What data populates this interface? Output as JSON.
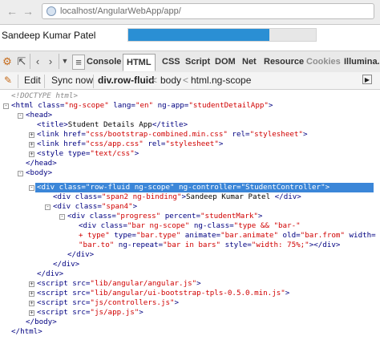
{
  "browser": {
    "url": "localhost/AngularWebApp/app/"
  },
  "page": {
    "student_name": "Sandeep Kumar Patel",
    "progress_percent": 75
  },
  "firebug": {
    "tabs": [
      {
        "label": "Console",
        "active": false,
        "dim": false
      },
      {
        "label": "HTML",
        "active": true,
        "dim": false
      },
      {
        "label": "CSS",
        "active": false,
        "dim": false
      },
      {
        "label": "Script",
        "active": false,
        "dim": false
      },
      {
        "label": "DOM",
        "active": false,
        "dim": false
      },
      {
        "label": "Net",
        "active": false,
        "dim": false
      },
      {
        "label": "Resource",
        "active": false,
        "dim": false
      },
      {
        "label": "Cookies",
        "active": false,
        "dim": true
      },
      {
        "label": "Illumina...",
        "active": false,
        "dim": false
      }
    ],
    "edit_label": "Edit",
    "sync_label": "Sync now",
    "breadcrumb": [
      "div.row-fluid",
      "body",
      "html.ng-scope"
    ]
  },
  "tree": {
    "doctype": "<!DOCTYPE html>",
    "lines": [
      [
        [
          "tg",
          "<html "
        ],
        [
          "an",
          "class="
        ],
        [
          "av",
          "\"ng-scope\""
        ],
        [
          "an",
          " lang="
        ],
        [
          "av",
          "\"en\""
        ],
        [
          "an",
          " ng-app="
        ],
        [
          "av",
          "\"studentDetailApp\""
        ],
        [
          "tg",
          ">"
        ]
      ],
      [
        [
          "tg",
          "<head>"
        ]
      ],
      [
        [
          "tg",
          "<title>"
        ],
        [
          "tx",
          "Student Details App"
        ],
        [
          "tg",
          "</title>"
        ]
      ],
      [
        [
          "tg",
          "<link "
        ],
        [
          "an",
          "href="
        ],
        [
          "av",
          "\"css/bootstrap-combined.min.css\""
        ],
        [
          "an",
          " rel="
        ],
        [
          "av",
          "\"stylesheet\""
        ],
        [
          "tg",
          ">"
        ]
      ],
      [
        [
          "tg",
          "<link "
        ],
        [
          "an",
          "href="
        ],
        [
          "av",
          "\"css/app.css\""
        ],
        [
          "an",
          " rel="
        ],
        [
          "av",
          "\"stylesheet\""
        ],
        [
          "tg",
          ">"
        ]
      ],
      [
        [
          "tg",
          "<style "
        ],
        [
          "an",
          "type="
        ],
        [
          "av",
          "\"text/css\""
        ],
        [
          "tg",
          ">"
        ]
      ],
      [
        [
          "tg",
          "</head>"
        ]
      ],
      [
        [
          "tg",
          "<body>"
        ]
      ],
      [
        [
          "tg",
          "<div "
        ],
        [
          "an",
          "class="
        ],
        [
          "av",
          "\"row-fluid ng-scope\""
        ],
        [
          "an",
          " ng-controller="
        ],
        [
          "av",
          "\"StudentController\""
        ],
        [
          "tg",
          ">"
        ]
      ],
      [
        [
          "tg",
          "<div "
        ],
        [
          "an",
          "class="
        ],
        [
          "av",
          "\"span2 ng-binding\""
        ],
        [
          "tg",
          ">"
        ],
        [
          "tx",
          "Sandeep Kumar Patel "
        ],
        [
          "tg",
          "</div>"
        ]
      ],
      [
        [
          "tg",
          "<div "
        ],
        [
          "an",
          "class="
        ],
        [
          "av",
          "\"span4\""
        ],
        [
          "tg",
          ">"
        ]
      ],
      [
        [
          "tg",
          "<div "
        ],
        [
          "an",
          "class="
        ],
        [
          "av",
          "\"progress\""
        ],
        [
          "an",
          " percent="
        ],
        [
          "av",
          "\"studentMark\""
        ],
        [
          "tg",
          ">"
        ]
      ],
      [
        [
          "tg",
          "<div "
        ],
        [
          "an",
          "class="
        ],
        [
          "av",
          "\"bar ng-scope\""
        ],
        [
          "an",
          " ng-class="
        ],
        [
          "av",
          "\"type && \"bar-\""
        ]
      ],
      [
        [
          "av",
          "+ type\""
        ],
        [
          "an",
          " type="
        ],
        [
          "av",
          "\"bar.type\""
        ],
        [
          "an",
          " animate="
        ],
        [
          "av",
          "\"bar.animate\""
        ],
        [
          "an",
          " old="
        ],
        [
          "av",
          "\"bar.from\""
        ],
        [
          "an",
          " width="
        ]
      ],
      [
        [
          "av",
          "\"bar.to\""
        ],
        [
          "an",
          " ng-repeat="
        ],
        [
          "av",
          "\"bar in bars\""
        ],
        [
          "an",
          " style="
        ],
        [
          "av",
          "\"width: 75%;\""
        ],
        [
          "tg",
          "></div>"
        ]
      ],
      [
        [
          "tg",
          "</div>"
        ]
      ],
      [
        [
          "tg",
          "</div>"
        ]
      ],
      [
        [
          "tg",
          "</div>"
        ]
      ],
      [
        [
          "tg",
          "<script "
        ],
        [
          "an",
          "src="
        ],
        [
          "av",
          "\"lib/angular/angular.js\""
        ],
        [
          "tg",
          ">"
        ]
      ],
      [
        [
          "tg",
          "<script "
        ],
        [
          "an",
          "src="
        ],
        [
          "av",
          "\"lib/angular/ui-bootstrap-tpls-0.5.0.min.js\""
        ],
        [
          "tg",
          ">"
        ]
      ],
      [
        [
          "tg",
          "<script "
        ],
        [
          "an",
          "src="
        ],
        [
          "av",
          "\"js/controllers.js\""
        ],
        [
          "tg",
          ">"
        ]
      ],
      [
        [
          "tg",
          "<script "
        ],
        [
          "an",
          "src="
        ],
        [
          "av",
          "\"js/app.js\""
        ],
        [
          "tg",
          ">"
        ]
      ],
      [
        [
          "tg",
          "</body>"
        ]
      ],
      [
        [
          "tg",
          "</html>"
        ]
      ]
    ]
  }
}
